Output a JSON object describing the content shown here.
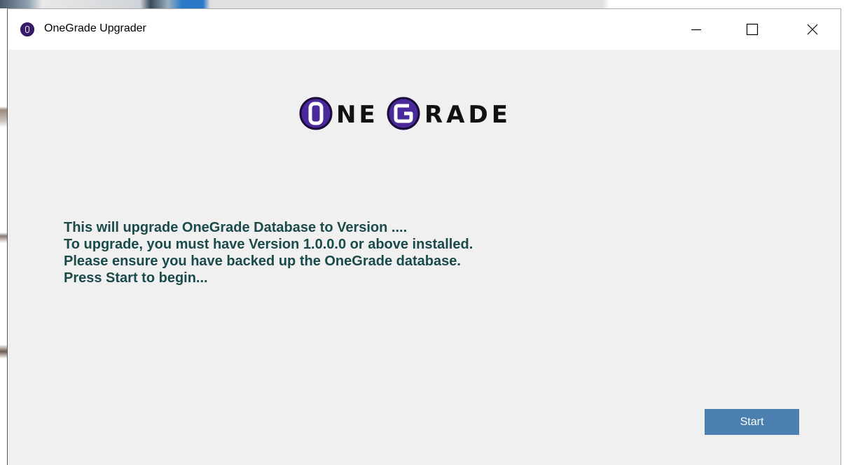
{
  "window": {
    "title": "OneGrade Upgrader",
    "icon": "onegrade-o-icon"
  },
  "logo": {
    "text": "ONEGRADE",
    "accent_color": "#4a2a9a"
  },
  "message": {
    "lines": [
      "This will upgrade OneGrade Database to Version ....",
      "To upgrade, you must have Version 1.0.0.0 or above installed.",
      "Please ensure you have backed up the OneGrade database.",
      "Press Start to begin..."
    ],
    "color": "#1a4a4a"
  },
  "actions": {
    "start_label": "Start"
  },
  "controls": {
    "minimize_icon": "minimize-icon",
    "maximize_icon": "maximize-icon",
    "close_icon": "close-icon"
  }
}
